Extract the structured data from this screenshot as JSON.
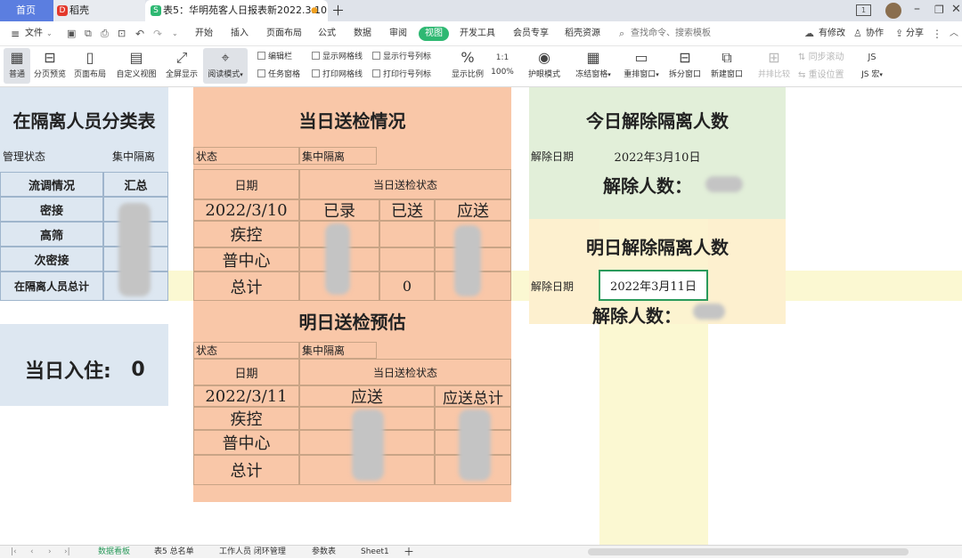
{
  "tabs": {
    "home": "首页",
    "daoke": "稻壳",
    "doc": "表5：华明苑客人日报表新2022.3.10"
  },
  "menu": {
    "file": "文件",
    "items": [
      "开始",
      "插入",
      "页面布局",
      "公式",
      "数据",
      "审阅",
      "视图",
      "开发工具",
      "会员专享",
      "稻壳资源"
    ],
    "active": "视图",
    "search": "查找命令、搜索模板",
    "pending": "有修改",
    "collab": "协作",
    "share": "分享"
  },
  "toolbar": {
    "normal": "普通",
    "pagebreak": "分页预览",
    "pagelayout": "页面布局",
    "customview": "自定义视图",
    "fullscreen": "全屏显示",
    "reading": "阅读模式",
    "editbar": "编辑栏",
    "taskpane": "任务窗格",
    "gridlines": "显示网格线",
    "printgrid": "打印网格线",
    "rowcolhdr": "显示行号列标",
    "printrowcol": "打印行号列标",
    "zoom": "显示比例",
    "zoom100": "100%",
    "eyecare": "护眼模式",
    "freeze": "冻结窗格",
    "arrange": "重排窗口",
    "split": "拆分窗口",
    "newwin": "新建窗口",
    "sidebyside": "并排比较",
    "syncscroll": "同步滚动",
    "resetpos": "重设位置",
    "macro": "JS 宏"
  },
  "sheet": {
    "left": {
      "title": "在隔离人员分类表",
      "status_label": "管理状态",
      "status_value": "集中隔离",
      "hdr1": "流调情况",
      "hdr2": "汇总",
      "rows": [
        "密接",
        "高筛",
        "次密接",
        "在隔离人员总计"
      ]
    },
    "checkin": {
      "label": "当日入住:",
      "value": "0"
    },
    "today": {
      "title": "当日送检情况",
      "status_label": "状态",
      "status_value": "集中隔离",
      "date_hdr": "日期",
      "state_hdr": "当日送检状态",
      "date": "2022/3/10",
      "cols": [
        "已录",
        "已送",
        "应送"
      ],
      "rows": [
        "疾控",
        "普中心",
        "总计"
      ],
      "total_sent": "0"
    },
    "tomorrow": {
      "title": "明日送检预估",
      "status_label": "状态",
      "status_value": "集中隔离",
      "date_hdr": "日期",
      "state_hdr": "当日送检状态",
      "date": "2022/3/11",
      "cols": [
        "应送",
        "应送总计"
      ],
      "rows": [
        "疾控",
        "普中心",
        "总计"
      ]
    },
    "release_today": {
      "title": "今日解除隔离人数",
      "date_label": "解除日期",
      "date": "2022年3月10日",
      "count_label": "解除人数："
    },
    "release_tomorrow": {
      "title": "明日解除隔离人数",
      "date_label": "解除日期",
      "date": "2022年3月11日",
      "count_label": "解除人数："
    }
  },
  "sheet_tabs": [
    "数据看板",
    "表5 总名单",
    "工作人员 闭环管理",
    "参数表",
    "Sheet1"
  ],
  "active_sheet": "数据看板",
  "colors": {
    "accent": "#2eb872",
    "blue_panel": "#dde7f1",
    "orange_panel": "#f9c7a8",
    "green_panel": "#e2efd9",
    "yellow_panel": "#fdf0cf"
  }
}
